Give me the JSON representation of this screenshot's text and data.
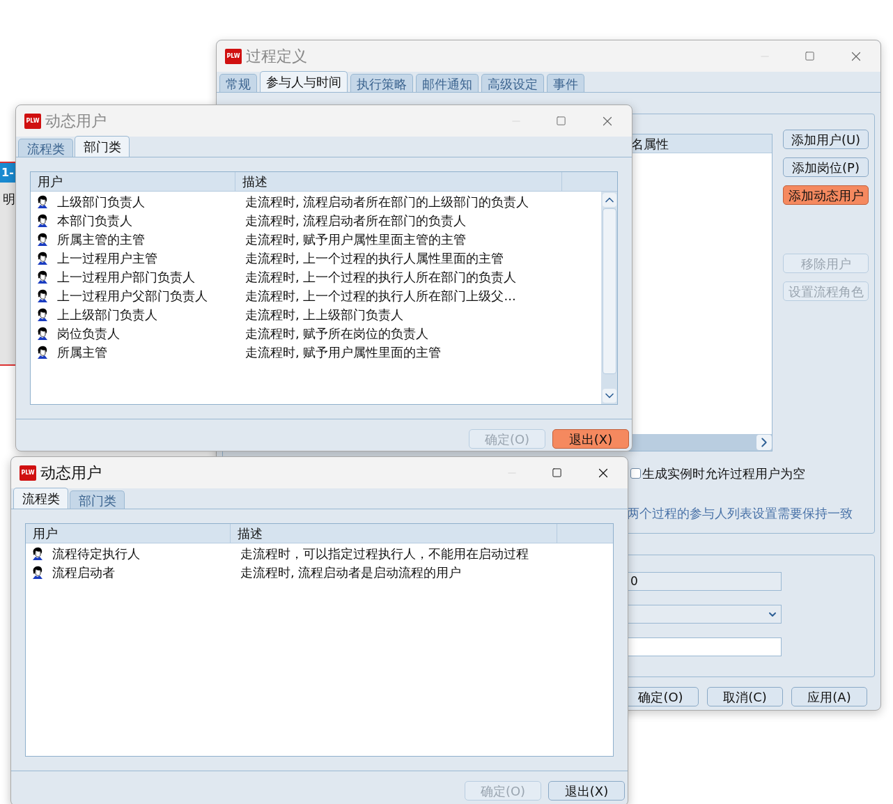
{
  "background_fragment": {
    "badge": "1-",
    "text": "明"
  },
  "process_window": {
    "logo": "PLW",
    "title": "过程定义",
    "active": false,
    "tabs": [
      {
        "label": "常规",
        "selected": false
      },
      {
        "label": "参与人与时间",
        "selected": true
      },
      {
        "label": "执行策略",
        "selected": false
      },
      {
        "label": "邮件通知",
        "selected": false
      },
      {
        "label": "高级设定",
        "selected": false
      },
      {
        "label": "事件",
        "selected": false
      }
    ],
    "list": {
      "column_header": "名属性"
    },
    "buttons": [
      {
        "label": "添加用户(U)",
        "highlighted": false,
        "disabled": false
      },
      {
        "label": "添加岗位(P)",
        "highlighted": false,
        "disabled": false
      },
      {
        "label": "添加动态用户",
        "highlighted": true,
        "disabled": false
      },
      {
        "label": "移除用户",
        "highlighted": false,
        "disabled": true
      },
      {
        "label": "设置流程角色",
        "highlighted": false,
        "disabled": true
      }
    ],
    "checkbox": {
      "label": "生成实例时允许过程用户为空",
      "checked": false
    },
    "note": "两个过程的参与人列表设置需要保持一致",
    "fields": [
      {
        "kind": "readonly",
        "value": "0"
      },
      {
        "kind": "dropdown"
      },
      {
        "kind": "input"
      }
    ],
    "footer_buttons": [
      {
        "label": "确定(O)",
        "highlighted": false,
        "disabled": false
      },
      {
        "label": "取消(C)",
        "highlighted": false,
        "disabled": false
      },
      {
        "label": "应用(A)",
        "highlighted": false,
        "disabled": false
      }
    ]
  },
  "dialogs": [
    {
      "logo": "PLW",
      "title": "动态用户",
      "active": false,
      "tabs": [
        {
          "label": "流程类",
          "selected": false
        },
        {
          "label": "部门类",
          "selected": true
        }
      ],
      "columns": [
        "用户",
        "描述"
      ],
      "rows": [
        {
          "user": "上级部门负责人",
          "description": "走流程时, 流程启动者所在部门的上级部门的负责人"
        },
        {
          "user": "本部门负责人",
          "description": "走流程时, 流程启动者所在部门的负责人"
        },
        {
          "user": "所属主管的主管",
          "description": "走流程时, 赋予用户属性里面主管的主管"
        },
        {
          "user": "上一过程用户主管",
          "description": "走流程时, 上一个过程的执行人属性里面的主管"
        },
        {
          "user": "上一过程用户部门负责人",
          "description": "走流程时, 上一个过程的执行人所在部门的负责人"
        },
        {
          "user": "上一过程用户父部门负责人",
          "description": "走流程时, 上一个过程的执行人所在部门上级父..."
        },
        {
          "user": "上上级部门负责人",
          "description": "走流程时, 上上级部门负责人"
        },
        {
          "user": "岗位负责人",
          "description": "走流程时, 赋予所在岗位的负责人"
        },
        {
          "user": "所属主管",
          "description": "走流程时, 赋予用户属性里面的主管"
        }
      ],
      "buttons": [
        {
          "label": "确定(O)",
          "highlighted": false,
          "disabled": true
        },
        {
          "label": "退出(X)",
          "highlighted": true,
          "disabled": false
        }
      ]
    },
    {
      "logo": "PLW",
      "title": "动态用户",
      "active": true,
      "tabs": [
        {
          "label": "流程类",
          "selected": true
        },
        {
          "label": "部门类",
          "selected": false
        }
      ],
      "columns": [
        "用户",
        "描述"
      ],
      "rows": [
        {
          "user": "流程待定执行人",
          "description": "走流程时，可以指定过程执行人，不能用在启动过程"
        },
        {
          "user": "流程启动者",
          "description": "走流程时, 流程启动者是启动流程的用户"
        }
      ],
      "buttons": [
        {
          "label": "确定(O)",
          "highlighted": false,
          "disabled": true
        },
        {
          "label": "退出(X)",
          "highlighted": false,
          "disabled": false
        }
      ]
    }
  ]
}
